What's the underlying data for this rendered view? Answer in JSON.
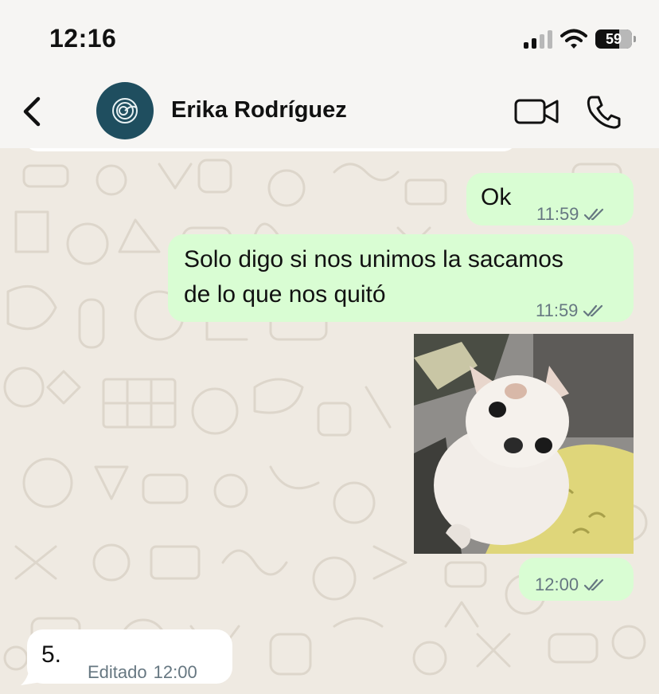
{
  "status_bar": {
    "time": "12:16",
    "battery": "59",
    "icons": [
      "signal-icon",
      "wifi-icon",
      "battery-icon"
    ]
  },
  "header": {
    "contact_name": "Erika Rodríguez",
    "icons": [
      "back-chevron-icon",
      "avatar-spiral-icon",
      "video-call-icon",
      "phone-icon"
    ]
  },
  "messages": [
    {
      "direction": "outgoing",
      "text": "Ok",
      "time": "11:59",
      "status": "read"
    },
    {
      "direction": "outgoing",
      "text_lines": [
        "Solo digo si nos unimos la sacamos",
        "de lo que nos quitó"
      ],
      "time": "11:59",
      "status": "read"
    },
    {
      "direction": "outgoing",
      "type": "image",
      "time": "12:00",
      "status": "read"
    },
    {
      "direction": "incoming",
      "text": "5.",
      "edited_label": "Editado",
      "time": "12:00"
    }
  ],
  "colors": {
    "outgoing_bubble": "#d9fdd3",
    "incoming_bubble": "#ffffff",
    "wallpaper": "#efeae2",
    "tick_color": "#667781",
    "avatar_bg": "#1f4e5f"
  }
}
